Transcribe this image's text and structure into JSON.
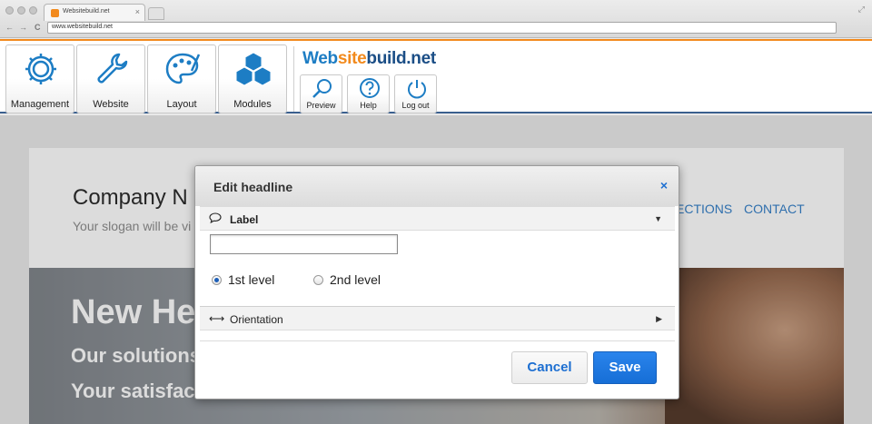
{
  "browser": {
    "tab_title": "Websitebuild.net",
    "tab_close": "×",
    "url": "www.websitebuild.net",
    "back": "←",
    "forward": "→",
    "reload": "C"
  },
  "toolbar": {
    "main_buttons": [
      {
        "label": "Management",
        "icon": "gear-icon"
      },
      {
        "label": "Website",
        "icon": "wrench-icon"
      },
      {
        "label": "Layout",
        "icon": "palette-icon"
      },
      {
        "label": "Modules",
        "icon": "cubes-icon"
      }
    ],
    "logo": {
      "part1": "Web",
      "part2": "site",
      "part3": "build.net"
    },
    "small_buttons": [
      {
        "label": "Preview",
        "icon": "magnifier-icon"
      },
      {
        "label": "Help",
        "icon": "question-icon"
      },
      {
        "label": "Log out",
        "icon": "power-icon"
      }
    ],
    "accent_color": "#f28a1d",
    "brand_color": "#1d7dc4"
  },
  "site": {
    "company": "Company N",
    "slogan": "Your slogan will be vi",
    "nav": [
      "ECTIONS",
      "CONTACT"
    ],
    "hero_headline": "New Hea",
    "hero_line1": "Our solutions",
    "hero_line2": "Your satisfac"
  },
  "dialog": {
    "title": "Edit headline",
    "close": "×",
    "label_section": {
      "title": "Label",
      "icon": "speech-bubble-icon",
      "arrow": "▼",
      "value": ""
    },
    "levels": [
      {
        "label": "1st level",
        "selected": true
      },
      {
        "label": "2nd level",
        "selected": false
      }
    ],
    "orientation_section": {
      "title": "Orientation",
      "icon": "horizontal-arrows-icon",
      "glyph": "⟷",
      "arrow": "▶"
    },
    "cancel_label": "Cancel",
    "save_label": "Save"
  }
}
